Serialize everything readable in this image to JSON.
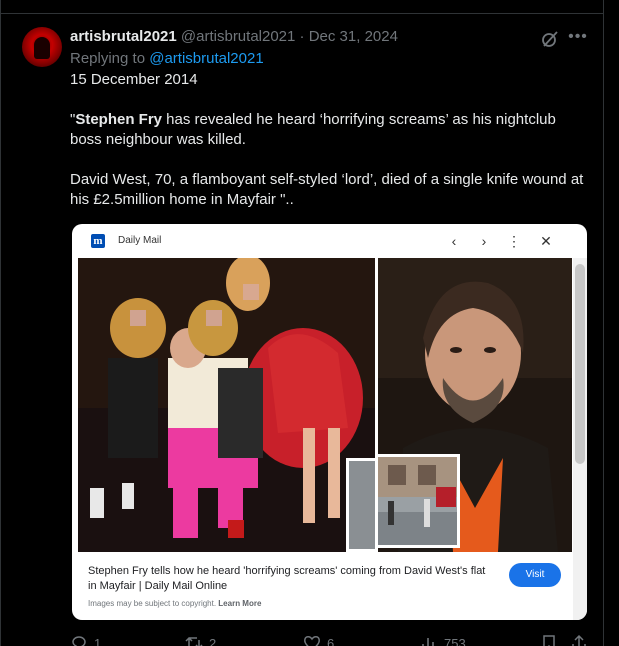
{
  "tweet": {
    "author_name": "artisbrutal2021",
    "author_handle": "@artisbrutal2021",
    "separator": "·",
    "date": "Dec 31, 2024",
    "replying_prefix": "Replying to",
    "replying_to": "@artisbrutal2021",
    "line1": "15 December 2014",
    "quote_open": "\"",
    "quote_bold": "Stephen Fry",
    "quote_rest": " has revealed he heard ‘horrifying screams’ as his nightclub boss neighbour was killed.",
    "para3": "David West, 70, a flamboyant self-styled ‘lord’, died of a single knife wound at his £2.5million home in Mayfair \".."
  },
  "card": {
    "site_name": "Daily Mail",
    "logo_letter": "m",
    "caption": "Stephen Fry tells how he heard 'horrifying screams' coming from David West's flat in Mayfair | Daily Mail Online",
    "visit_label": "Visit",
    "copyright_text": "Images may be subject to copyright.",
    "learn_more": "Learn More"
  },
  "actions": {
    "replies": "1",
    "reposts": "2",
    "likes": "6",
    "views": "753"
  },
  "colors": {
    "background": "#000000",
    "link": "#1d9bf0",
    "muted": "#71767b",
    "visit_button": "#1a73e8"
  }
}
